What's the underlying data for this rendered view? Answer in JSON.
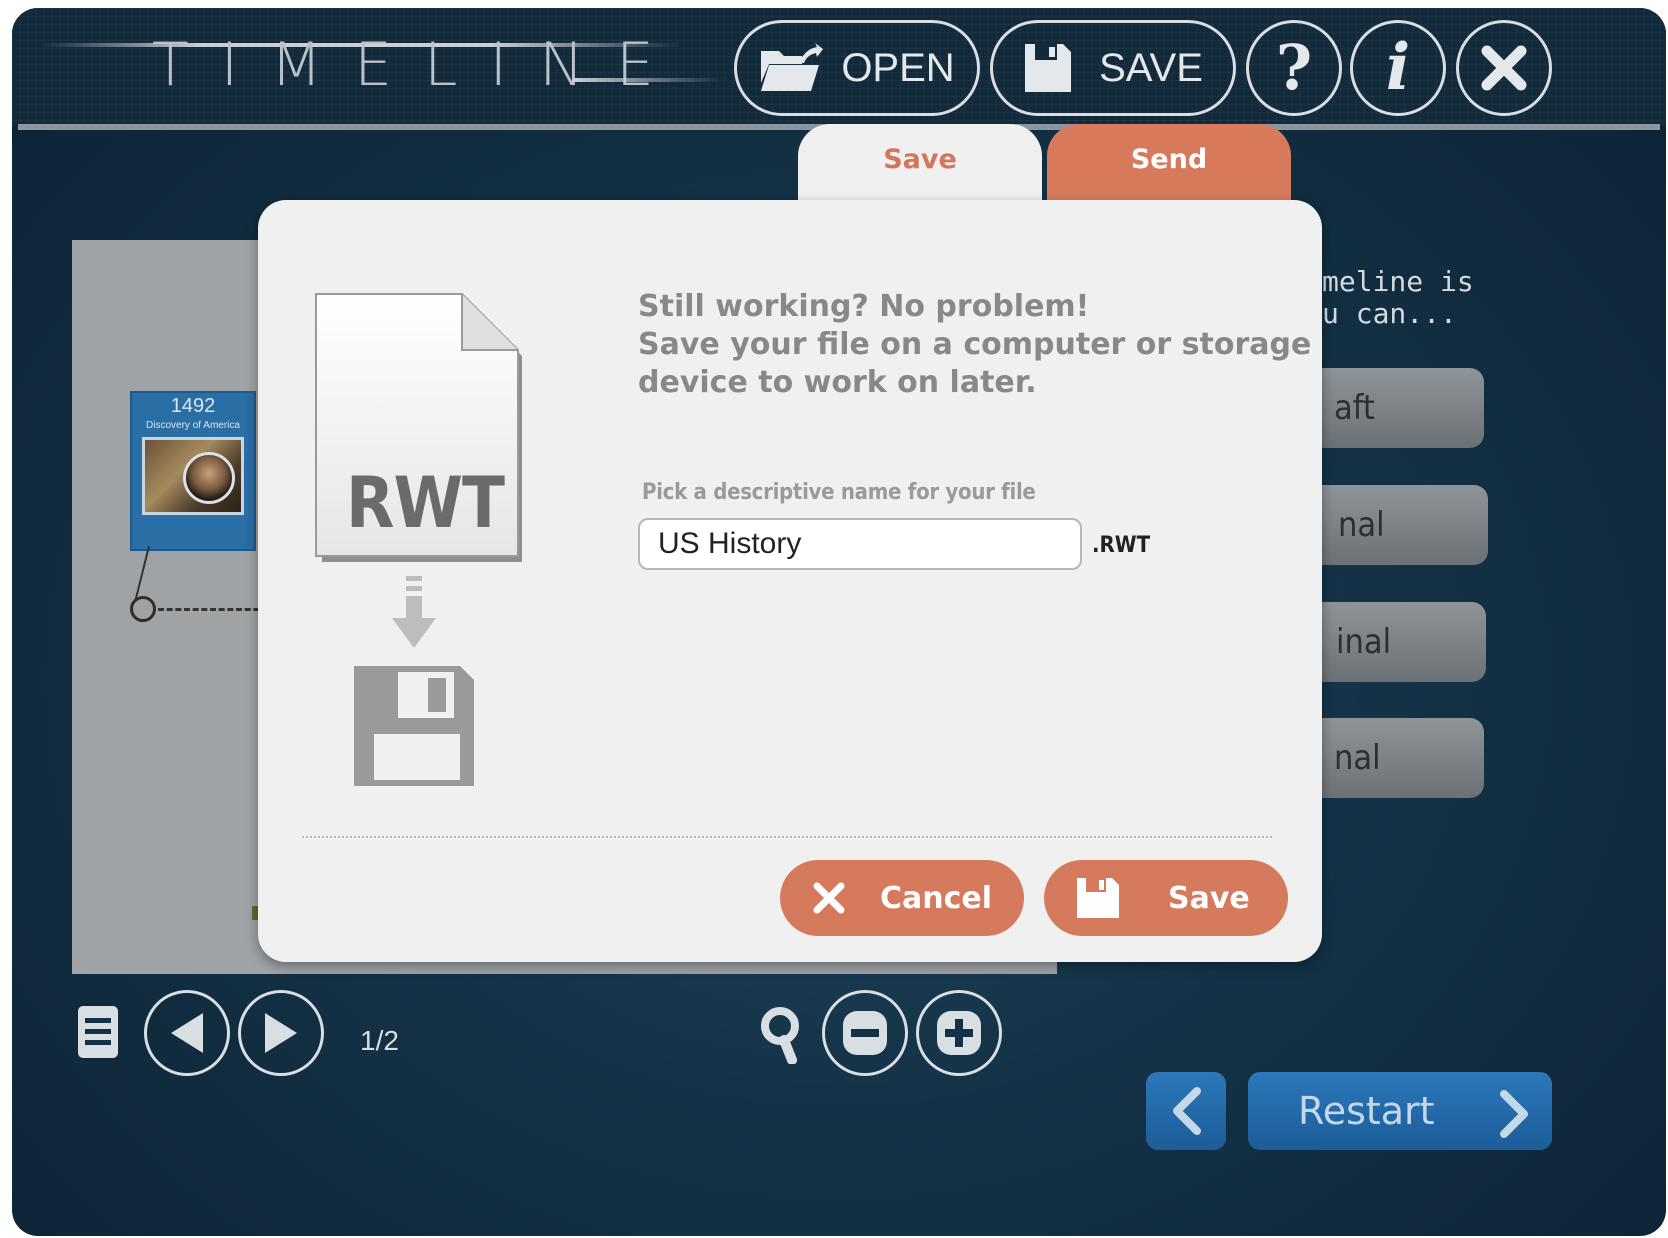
{
  "app": {
    "title": "TIMELINE"
  },
  "header": {
    "open_label": "OPEN",
    "save_label": "SAVE",
    "help_icon": "question-mark-icon",
    "info_icon": "info-icon",
    "close_icon": "close-icon"
  },
  "timeline": {
    "card_year": "1492",
    "card_event": "Discovery of America"
  },
  "side_panel": {
    "text_line1": "meline is",
    "text_line2": "u can...",
    "buttons": [
      "aft",
      "nal",
      "inal",
      "nal"
    ]
  },
  "bottom": {
    "page": "1/2",
    "restart_label": "Restart"
  },
  "dialog": {
    "tabs": [
      "Save",
      "Send"
    ],
    "active_tab": "Save",
    "doc_label": "RWT",
    "message": [
      "Still working? No problem!",
      "Save your file on a computer or storage",
      "device to work on later."
    ],
    "field_label": "Pick a descriptive name for your file",
    "file_name": "US History",
    "extension": ".RWT",
    "cancel_label": "Cancel",
    "save_label": "Save"
  },
  "colors": {
    "accent": "#d67a5d",
    "background": "#143247",
    "dialog": "#f0f0f0",
    "nav_blue": "#2370b0"
  }
}
